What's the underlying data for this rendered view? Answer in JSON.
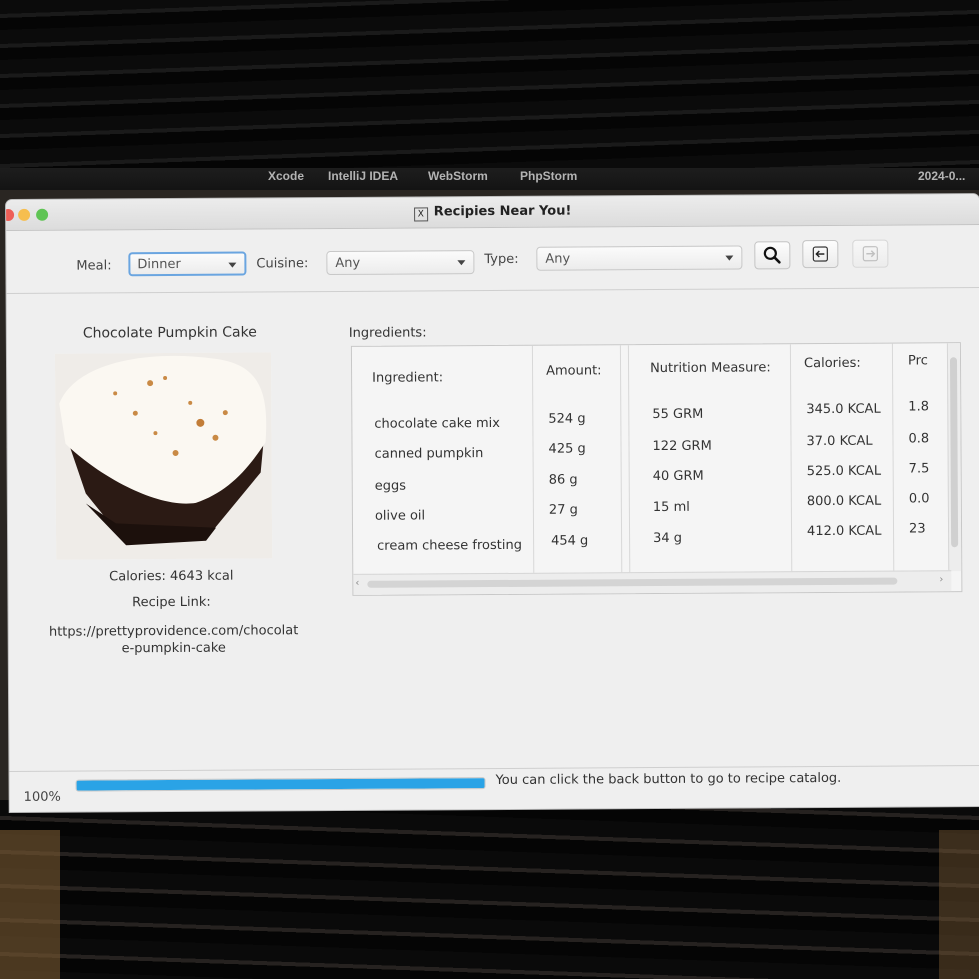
{
  "desktop": {
    "dock_labels": [
      "Xcode",
      "IntelliJ IDEA",
      "WebStorm",
      "PhpStorm",
      "2024-0..."
    ]
  },
  "window": {
    "title": "Recipies Near You!",
    "app_icon": "X"
  },
  "toolbar": {
    "meal_label": "Meal:",
    "meal_value": "Dinner",
    "cuisine_label": "Cuisine:",
    "cuisine_value": "Any",
    "type_label": "Type:",
    "type_value": "Any",
    "search_icon": "search-icon",
    "back_icon": "arrow-left-icon",
    "forward_icon": "arrow-right-icon"
  },
  "recipe": {
    "name": "Chocolate Pumpkin Cake",
    "calories_text": "Calories: 4643 kcal",
    "link_label": "Recipe Link:",
    "link_url": "https://prettyprovidence.com/chocolate-pumpkin-cake"
  },
  "ingredients": {
    "label": "Ingredients:",
    "columns": [
      "Ingredient:",
      "Amount:",
      "Nutrition Measure:",
      "Calories:",
      "Prc"
    ],
    "rows": [
      [
        "chocolate cake mix",
        "524 g",
        "55 GRM",
        "345.0 KCAL",
        "1.8"
      ],
      [
        "canned pumpkin",
        "425 g",
        "122 GRM",
        "37.0 KCAL",
        "0.8"
      ],
      [
        "eggs",
        "86 g",
        "40 GRM",
        "525.0 KCAL",
        "7.5"
      ],
      [
        "olive oil",
        "27 g",
        "15 ml",
        "800.0 KCAL",
        "0.0"
      ],
      [
        "cream cheese frosting",
        "454 g",
        "34 g",
        "412.0 KCAL",
        "23"
      ]
    ]
  },
  "status": {
    "zoom": "100%",
    "progress": 1.0,
    "message": "You can click the back button to go to recipe catalog.",
    "progress_color": "#2aa3e6"
  }
}
